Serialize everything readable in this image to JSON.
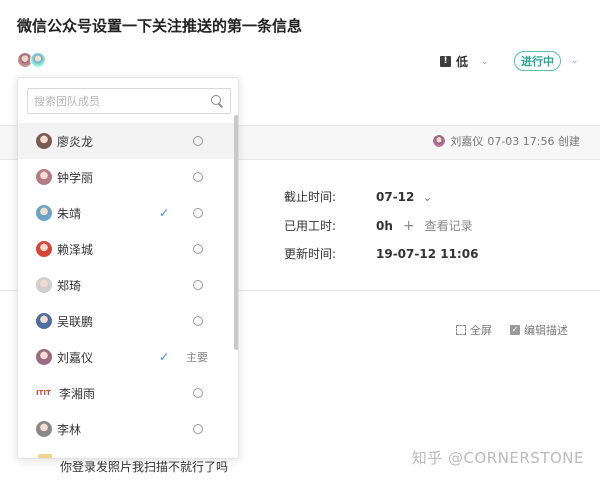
{
  "task": {
    "title": "微信公众号设置一下关注推送的第一条信息",
    "priority_icon": "!",
    "priority": "低",
    "status": "进行中"
  },
  "creator": {
    "name": "刘嘉仪",
    "created": "07-03 17:56 创建"
  },
  "fields": {
    "deadline_label": "截止时间:",
    "deadline_value": "07-12",
    "worktime_label": "已用工时:",
    "worktime_value": "0h",
    "worktime_plus": "+",
    "worktime_link": "查看记录",
    "updated_label": "更新时间:",
    "updated_value": "19-07-12 11:06"
  },
  "tools": {
    "fullscreen": "全屏",
    "edit": "编辑描述"
  },
  "comment": "你登录发照片我扫描不就行了吗",
  "watermark": "知乎 @CORNERSTONE",
  "member_picker": {
    "search_placeholder": "搜索团队成员",
    "members": [
      {
        "name": "廖炎龙",
        "selected": false,
        "main": false,
        "hover": true,
        "color": "#7b5a52"
      },
      {
        "name": "钟学丽",
        "selected": false,
        "main": false,
        "hover": false,
        "color": "#b77b86"
      },
      {
        "name": "朱靖",
        "selected": true,
        "main": false,
        "hover": false,
        "color": "#6aa5c8"
      },
      {
        "name": "赖泽城",
        "selected": false,
        "main": false,
        "hover": false,
        "color": "#d9443a"
      },
      {
        "name": "郑琦",
        "selected": false,
        "main": false,
        "hover": false,
        "color": "#cfcfcf"
      },
      {
        "name": "吴联鹏",
        "selected": false,
        "main": false,
        "hover": false,
        "color": "#4d6e9e"
      },
      {
        "name": "刘嘉仪",
        "selected": true,
        "main": true,
        "main_label": "主要",
        "hover": false,
        "color": "#9b6b84"
      },
      {
        "name": "李湘雨",
        "selected": false,
        "main": false,
        "hover": false,
        "color": "#d04a3a",
        "avatar_text": "ITIT"
      },
      {
        "name": "李林",
        "selected": false,
        "main": false,
        "hover": false,
        "color": "#8a8a8a"
      }
    ]
  }
}
